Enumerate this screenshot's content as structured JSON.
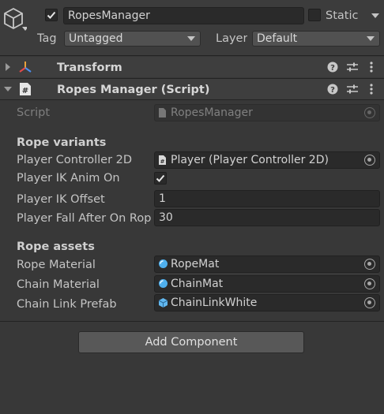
{
  "header": {
    "active": true,
    "object_name": "RopesManager",
    "static_label": "Static",
    "static_checked": false,
    "tag_label": "Tag",
    "tag_value": "Untagged",
    "layer_label": "Layer",
    "layer_value": "Default"
  },
  "components": {
    "transform": {
      "title": "Transform",
      "expanded": false
    },
    "ropes_manager": {
      "title": "Ropes Manager (Script)",
      "expanded": true,
      "script_label": "Script",
      "script_value": "RopesManager",
      "sections": {
        "rope_variants": {
          "title": "Rope variants",
          "player_controller_label": "Player Controller 2D",
          "player_controller_value": "Player (Player Controller 2D)",
          "ik_anim_label": "Player IK Anim On",
          "ik_anim_checked": true,
          "ik_offset_label": "Player IK Offset",
          "ik_offset_value": "1",
          "fall_after_label": "Player Fall After On Rope",
          "fall_after_value": "30"
        },
        "rope_assets": {
          "title": "Rope assets",
          "rope_material_label": "Rope Material",
          "rope_material_value": "RopeMat",
          "chain_material_label": "Chain Material",
          "chain_material_value": "ChainMat",
          "chain_link_label": "Chain Link Prefab",
          "chain_link_value": "ChainLinkWhite"
        }
      }
    }
  },
  "add_component_label": "Add Component",
  "icons": {
    "gameobject": "cube-outline-icon",
    "transform": "transform-axes-icon",
    "script": "csharp-script-icon",
    "help": "help-icon",
    "preset": "preset-sliders-icon",
    "menu": "kebab-menu-icon",
    "material": "material-sphere-icon",
    "prefab": "prefab-cube-icon",
    "object_picker": "object-picker-icon"
  },
  "colors": {
    "background": "#383838",
    "header": "#3c3c3c",
    "field": "#2a2a2a",
    "button": "#585858",
    "material_icon": "#4fb0ee",
    "prefab_icon": "#62b8f0"
  }
}
